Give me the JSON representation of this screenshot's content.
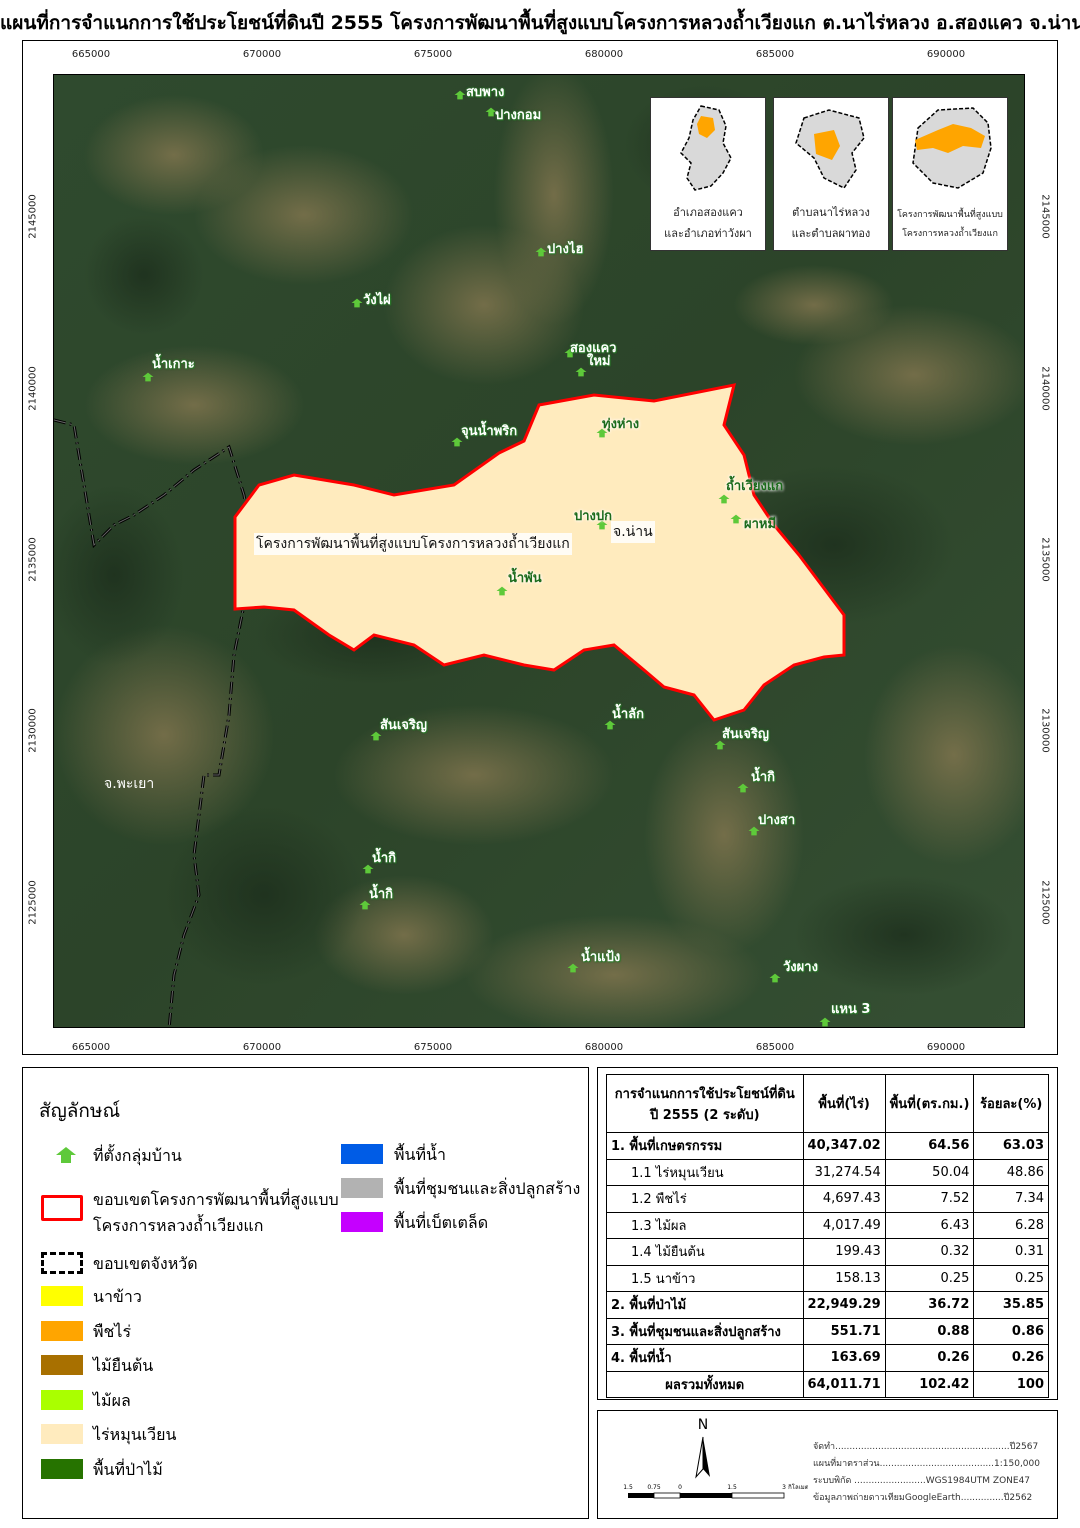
{
  "title": "แผนที่การจำแนกการใช้ประโยชน์ที่ดินปี 2555 โครงการพัฒนาพื้นที่สูงแบบโครงการหลวงถ้ำเวียงแก ต.นาไร่หลวง อ.สองแคว จ.น่าน",
  "map": {
    "x_ticks": [
      "665000",
      "670000",
      "675000",
      "680000",
      "685000",
      "690000"
    ],
    "y_ticks": [
      "2145000",
      "2140000",
      "2135000",
      "2130000",
      "2125000"
    ],
    "project_label": "โครงการพัฒนาพื้นที่สูงแบบโครงการหลวงถ้ำเวียงแก",
    "province_nan": "จ.น่าน",
    "province_phayao": "จ.พะเยา",
    "villages": [
      {
        "name": "สบพาง",
        "inside": false
      },
      {
        "name": "ปางกอม",
        "inside": false
      },
      {
        "name": "ปางไฮ",
        "inside": false
      },
      {
        "name": "วังไผ่",
        "inside": false
      },
      {
        "name": "สองแคว",
        "inside": false
      },
      {
        "name": "ใหม่",
        "inside": false
      },
      {
        "name": "น้ำเกาะ",
        "inside": false
      },
      {
        "name": "ทุ่งห่าง",
        "inside": true
      },
      {
        "name": "จุนน้ำพริก",
        "inside": false
      },
      {
        "name": "ถ้ำเวียงแก",
        "inside": true
      },
      {
        "name": "ปางปก",
        "inside": true
      },
      {
        "name": "ผาหมี",
        "inside": true
      },
      {
        "name": "น้ำพัน",
        "inside": true
      },
      {
        "name": "น้ำลัก",
        "inside": false
      },
      {
        "name": "สันเจริญ",
        "inside": false
      },
      {
        "name": "สันเจริญ",
        "inside": false
      },
      {
        "name": "น้ำกิ",
        "inside": false
      },
      {
        "name": "ปางสา",
        "inside": false
      },
      {
        "name": "น้ำกิ",
        "inside": false
      },
      {
        "name": "น้ำกิ",
        "inside": false
      },
      {
        "name": "น้ำแป้ง",
        "inside": false
      },
      {
        "name": "วังผาง",
        "inside": false
      },
      {
        "name": "แหน 3",
        "inside": false
      }
    ],
    "insets": [
      {
        "line1": "อำเภอสองแคว",
        "line2": "และอำเภอท่าวังผา"
      },
      {
        "line1": "ตำบลนาไร่หลวง",
        "line2": "และตำบลผาทอง"
      },
      {
        "line1": "โครงการพัฒนาพื้นที่สูงแบบ",
        "line2": "โครงการหลวงถ้ำเวียงแก"
      }
    ]
  },
  "legend": {
    "title": "สัญลักษณ์",
    "village": "ที่ตั้งกลุ่มบ้าน",
    "project_boundary_1": "ขอบเขตโครงการพัฒนาพื้นที่สูงแบบ",
    "project_boundary_2": "โครงการหลวงถ้ำเวียงแก",
    "province_boundary": "ขอบเขตจังหวัด",
    "classes_left": [
      {
        "label": "นาข้าว",
        "color": "#ffff00"
      },
      {
        "label": "พืชไร่",
        "color": "#ffa500"
      },
      {
        "label": "ไม้ยืนต้น",
        "color": "#a87000"
      },
      {
        "label": "ไม้ผล",
        "color": "#aaff00"
      },
      {
        "label": "ไร่หมุนเวียน",
        "color": "#ffebbe"
      },
      {
        "label": "พื้นที่ป่าไม้",
        "color": "#267300"
      }
    ],
    "classes_right": [
      {
        "label": "พื้นที่น้ำ",
        "color": "#005ce6"
      },
      {
        "label": "พื้นที่ชุมชนและสิ่งปลูกสร้าง",
        "color": "#b2b2b2"
      },
      {
        "label": "พื้นที่เบ็ตเตล็ด",
        "color": "#c500ff"
      }
    ]
  },
  "table": {
    "header": {
      "class_line1": "การจำแนกการใช้ประโยชน์ที่ดิน",
      "class_line2": "ปี 2555 (2 ระดับ)",
      "rai": "พื้นที่(ไร่)",
      "sqkm": "พื้นที่(ตร.กม.)",
      "pct": "ร้อยละ(%)"
    },
    "rows": [
      {
        "label": "1. พื้นที่เกษตรกรรม",
        "rai": "40,347.02",
        "sqkm": "64.56",
        "pct": "63.03",
        "level": "main"
      },
      {
        "label": "1.1 ไร่หมุนเวียน",
        "rai": "31,274.54",
        "sqkm": "50.04",
        "pct": "48.86",
        "level": "sub"
      },
      {
        "label": "1.2 พืชไร่",
        "rai": "4,697.43",
        "sqkm": "7.52",
        "pct": "7.34",
        "level": "sub"
      },
      {
        "label": "1.3 ไม้ผล",
        "rai": "4,017.49",
        "sqkm": "6.43",
        "pct": "6.28",
        "level": "sub"
      },
      {
        "label": "1.4 ไม้ยืนต้น",
        "rai": "199.43",
        "sqkm": "0.32",
        "pct": "0.31",
        "level": "sub"
      },
      {
        "label": "1.5 นาข้าว",
        "rai": "158.13",
        "sqkm": "0.25",
        "pct": "0.25",
        "level": "sub"
      },
      {
        "label": "2. พื้นที่ป่าไม้",
        "rai": "22,949.29",
        "sqkm": "36.72",
        "pct": "35.85",
        "level": "main"
      },
      {
        "label": "3. พื้นที่ชุมชนและสิ่งปลูกสร้าง",
        "rai": "551.71",
        "sqkm": "0.88",
        "pct": "0.86",
        "level": "main"
      },
      {
        "label": "4. พื้นที่น้ำ",
        "rai": "163.69",
        "sqkm": "0.26",
        "pct": "0.26",
        "level": "main"
      }
    ],
    "total": {
      "label": "ผลรวมทั้งหมด",
      "rai": "64,011.71",
      "sqkm": "102.42",
      "pct": "100"
    }
  },
  "info": {
    "north": "N",
    "scale_labels": [
      "1.5",
      "0.75",
      "0",
      "1.5",
      "3",
      "กิโลเมตร"
    ],
    "made": "จัดทำ.............................................................ปี2567",
    "scale": "แผนที่มาตราส่วน........................................1:150,000",
    "coord": "ระบบพิกัด .........................WGS1984UTM ZONE47",
    "imagery": "ข้อมูลภาพถ่ายดาวเทียมGoogleEarth...............ปี2562"
  }
}
